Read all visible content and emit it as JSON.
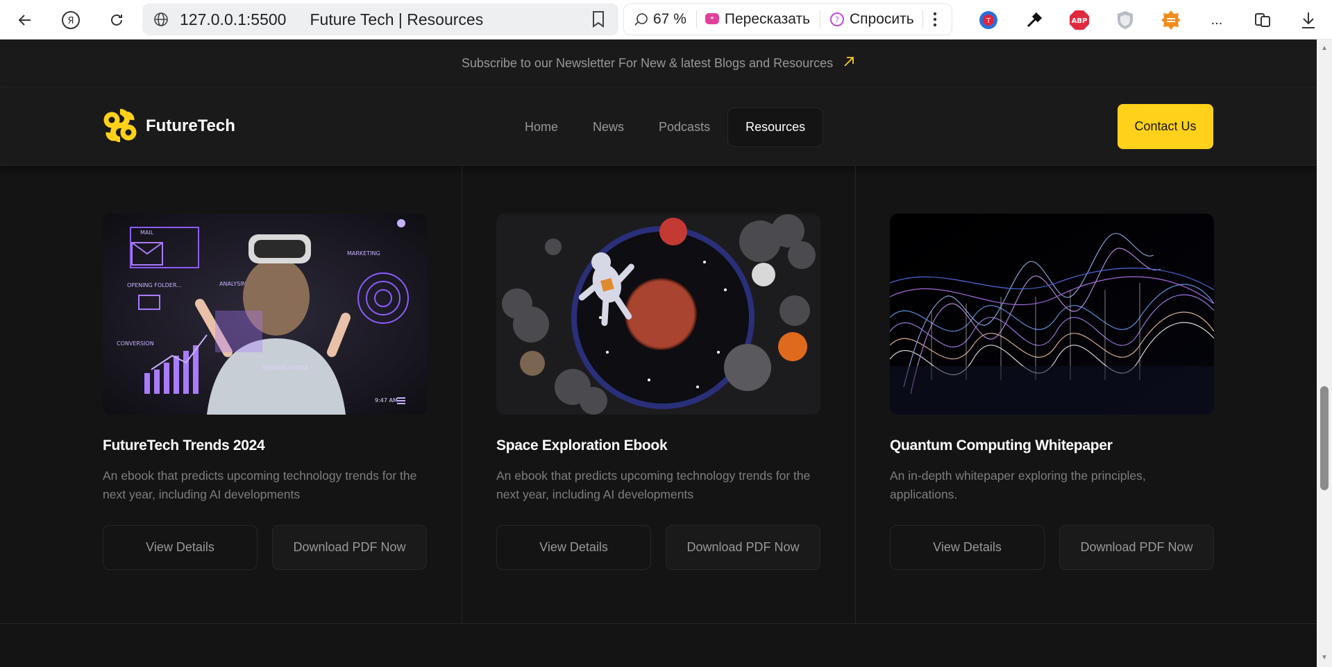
{
  "browser": {
    "url": "127.0.0.1:5500",
    "tab_title": "Future Tech | Resources",
    "zoom": "67 %",
    "retell_label": "Пересказать",
    "ask_label": "Спросить",
    "more_label": "..."
  },
  "site": {
    "newsletter": "Subscribe to our Newsletter For New & latest Blogs and Resources",
    "logo_text": "FutureTech",
    "nav": [
      {
        "label": "Home"
      },
      {
        "label": "News"
      },
      {
        "label": "Podcasts"
      },
      {
        "label": "Resources"
      }
    ],
    "contact_label": "Contact Us",
    "accent": "#ffd11a"
  },
  "cards": [
    {
      "title": "FutureTech Trends 2024",
      "description": "An ebook that predicts upcoming technology trends for the next year, including AI developments",
      "view_label": "View Details",
      "download_label": "Download PDF Now",
      "img_labels": {
        "mail": "MAIL",
        "folder": "OPENING FOLDER...",
        "analysing": "ANALYSING...",
        "marketing": "MARKETING",
        "conversion": "CONVERSION",
        "research": "RESEARCH DATA",
        "time": "9:47 AM"
      }
    },
    {
      "title": "Space Exploration Ebook",
      "description": "An ebook that predicts upcoming technology trends for the next year, including AI developments",
      "view_label": "View Details",
      "download_label": "Download PDF Now"
    },
    {
      "title": "Quantum Computing Whitepaper",
      "description": "An in-depth whitepaper exploring the principles, applications.",
      "view_label": "View Details",
      "download_label": "Download PDF Now"
    }
  ]
}
